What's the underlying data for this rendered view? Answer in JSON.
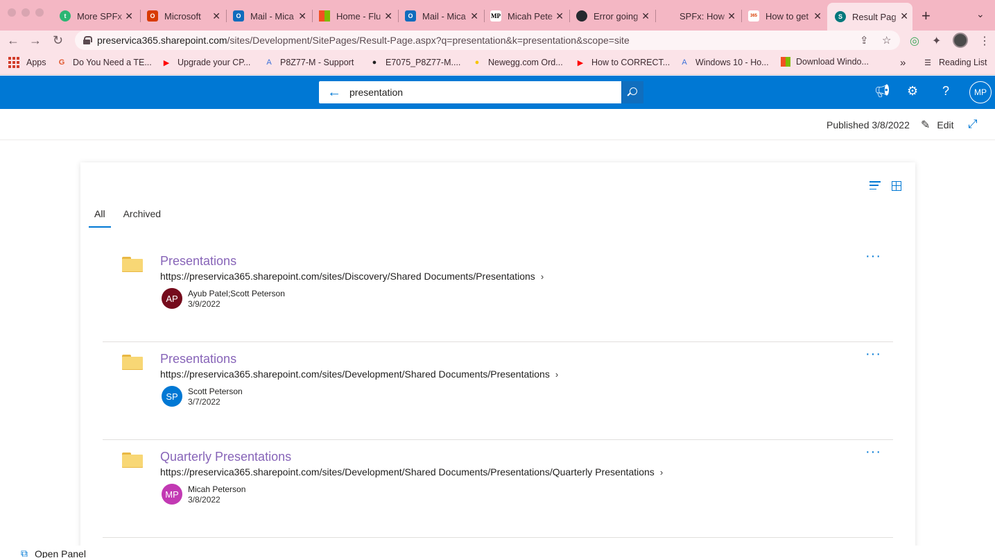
{
  "browser": {
    "tabs": [
      {
        "title": "More SPFx",
        "icon": "t-app-icon",
        "color": "#2bb673",
        "glyph": "t"
      },
      {
        "title": "Microsoft",
        "icon": "office-icon",
        "color": "#d83b01",
        "glyph": "O"
      },
      {
        "title": "Mail - Mica",
        "icon": "outlook-icon",
        "color": "#0f6cbd",
        "glyph": "O"
      },
      {
        "title": "Home - Flu",
        "icon": "microsoft-icon",
        "color": "#f25022",
        "glyph": ""
      },
      {
        "title": "Mail - Mica",
        "icon": "outlook-icon",
        "color": "#0f6cbd",
        "glyph": "O"
      },
      {
        "title": "Micah Pete",
        "icon": "mp-icon",
        "color": "#ffffff",
        "glyph": "MP"
      },
      {
        "title": "Error going",
        "icon": "github-icon",
        "color": "#24292f",
        "glyph": "●"
      },
      {
        "title": "SPFx: How",
        "icon": "blank-icon",
        "color": "#f4b7c4",
        "glyph": ""
      },
      {
        "title": "How to get",
        "icon": "office365-icon",
        "color": "#ffffff",
        "glyph": "365"
      },
      {
        "title": "Result Pag",
        "icon": "sharepoint-icon",
        "color": "#03787c",
        "glyph": "S"
      }
    ],
    "url_host": "preservica365.sharepoint.com",
    "url_path": "/sites/Development/SitePages/Result-Page.aspx?q=presentation&k=presentation&scope=site",
    "bookmarks": [
      {
        "label": "Apps",
        "icon": "apps-icon"
      },
      {
        "label": "Do You Need a TE...",
        "icon": "g-icon",
        "glyph": "G",
        "color": "#e0582f"
      },
      {
        "label": "Upgrade your CP...",
        "icon": "youtube-icon",
        "glyph": "▶",
        "color": "#ff0000"
      },
      {
        "label": "P8Z77-M - Support",
        "icon": "asus-icon",
        "glyph": "A",
        "color": "#3b6fd9"
      },
      {
        "label": "E7075_P8Z77-M....",
        "icon": "globe-icon",
        "glyph": "●",
        "color": "#202020"
      },
      {
        "label": "Newegg.com Ord...",
        "icon": "newegg-icon",
        "glyph": "●",
        "color": "#f7c600"
      },
      {
        "label": "How to CORRECT...",
        "icon": "youtube-icon",
        "glyph": "▶",
        "color": "#ff0000"
      },
      {
        "label": "Windows 10 - Ho...",
        "icon": "asus-icon",
        "glyph": "A",
        "color": "#3b6fd9"
      },
      {
        "label": "Download Windo...",
        "icon": "microsoft-icon",
        "glyph": "",
        "color": "#f25022"
      }
    ],
    "reading_list": "Reading List"
  },
  "suitebar": {
    "search_value": "presentation",
    "avatar_initials": "MP"
  },
  "page": {
    "published": "Published 3/8/2022",
    "edit_label": "Edit"
  },
  "results_panel": {
    "tabs": [
      "All",
      "Archived"
    ],
    "results": [
      {
        "title": "Presentations",
        "url": "https://preservica365.sharepoint.com/sites/Discovery/Shared Documents/Presentations",
        "author": "Ayub Patel;Scott Peterson",
        "date": "3/9/2022",
        "initials": "AP",
        "avatar_color": "#750b1c"
      },
      {
        "title": "Presentations",
        "url": "https://preservica365.sharepoint.com/sites/Development/Shared Documents/Presentations",
        "author": "Scott Peterson",
        "date": "3/7/2022",
        "initials": "SP",
        "avatar_color": "#0078d4"
      },
      {
        "title": "Quarterly Presentations",
        "url": "https://preservica365.sharepoint.com/sites/Development/Shared Documents/Presentations/Quarterly Presentations",
        "author": "Micah Peterson",
        "date": "3/8/2022",
        "initials": "MP",
        "avatar_color": "#c239b3"
      }
    ]
  },
  "bottom": {
    "open_panel": "Open Panel"
  },
  "colors": {
    "accent": "#0078d4",
    "title_purple": "#8764b8"
  }
}
